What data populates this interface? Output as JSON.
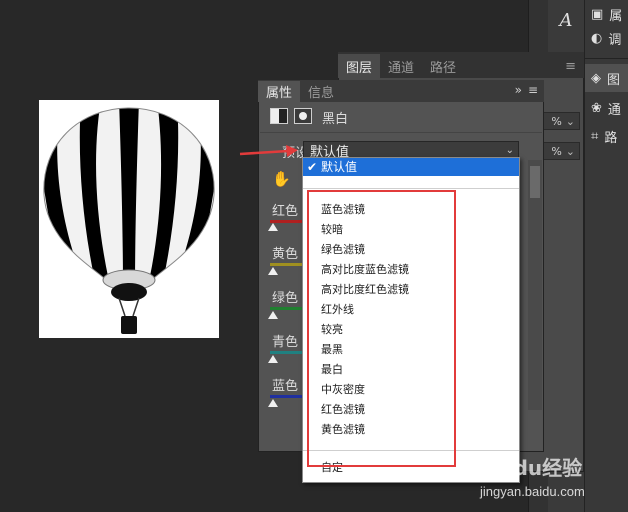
{
  "layers_panel": {
    "tabs": [
      "图层",
      "通道",
      "路径"
    ],
    "active_tab": 0,
    "opacity_value": "%",
    "fill_value": "%"
  },
  "properties_panel": {
    "tabs": [
      "属性",
      "信息"
    ],
    "active_tab": 0,
    "adjustment_name": "黑白",
    "preset_label": "预设",
    "preset_value": "默认值",
    "sliders": [
      {
        "label": "红色",
        "color": "#b02020"
      },
      {
        "label": "黄色",
        "color": "#a09020"
      },
      {
        "label": "绿色",
        "color": "#208030"
      },
      {
        "label": "青色",
        "color": "#208080"
      },
      {
        "label": "蓝色",
        "color": "#2030a0"
      }
    ]
  },
  "preset_dropdown": {
    "selected": "默认值",
    "items": [
      "蓝色滤镜",
      "较暗",
      "绿色滤镜",
      "高对比度蓝色滤镜",
      "高对比度红色滤镜",
      "红外线",
      "较亮",
      "最黑",
      "最白",
      "中灰密度",
      "红色滤镜",
      "黄色滤镜"
    ],
    "custom": "自定"
  },
  "right_panel": {
    "rows": [
      "属",
      "调",
      "图",
      "通",
      "路"
    ]
  },
  "watermark": {
    "brand": "Baidu经验",
    "url": "jingyan.baidu.com"
  },
  "colors": {
    "annotation_red": "#e23b3b",
    "selection_blue": "#1e6fd8"
  }
}
